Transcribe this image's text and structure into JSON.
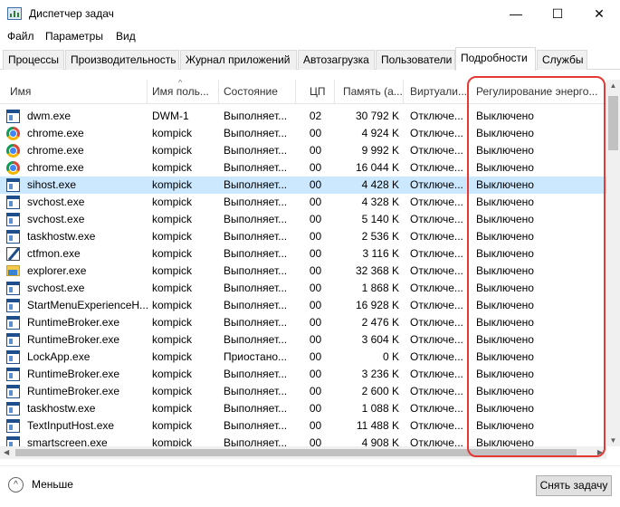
{
  "window": {
    "title": "Диспетчер задач",
    "minimize_glyph": "—",
    "maximize_glyph": "☐",
    "close_glyph": "✕",
    "icon": "task-manager-icon"
  },
  "menu": [
    "Файл",
    "Параметры",
    "Вид"
  ],
  "tabs": [
    {
      "label": "Процессы",
      "active": false
    },
    {
      "label": "Производительность",
      "active": false
    },
    {
      "label": "Журнал приложений",
      "active": false
    },
    {
      "label": "Автозагрузка",
      "active": false
    },
    {
      "label": "Пользователи",
      "active": false
    },
    {
      "label": "Подробности",
      "active": true
    },
    {
      "label": "Службы",
      "active": false
    }
  ],
  "columns": [
    "Имя",
    "Имя поль...",
    "Состояние",
    "ЦП",
    "Память (а...",
    "Виртуали...",
    "Регулирование энерго..."
  ],
  "sort_indicator": "^",
  "rows": [
    {
      "icon": "window-icon",
      "name": "dwm.exe",
      "user": "DWM-1",
      "status": "Выполняет...",
      "cpu": "02",
      "memory": "30 792 K",
      "virt": "Отключе...",
      "power": "Выключено",
      "selected": false
    },
    {
      "icon": "chrome-icon",
      "name": "chrome.exe",
      "user": "kompick",
      "status": "Выполняет...",
      "cpu": "00",
      "memory": "4 924 K",
      "virt": "Отключе...",
      "power": "Выключено",
      "selected": false
    },
    {
      "icon": "chrome-icon",
      "name": "chrome.exe",
      "user": "kompick",
      "status": "Выполняет...",
      "cpu": "00",
      "memory": "9 992 K",
      "virt": "Отключе...",
      "power": "Выключено",
      "selected": false
    },
    {
      "icon": "chrome-icon",
      "name": "chrome.exe",
      "user": "kompick",
      "status": "Выполняет...",
      "cpu": "00",
      "memory": "16 044 K",
      "virt": "Отключе...",
      "power": "Выключено",
      "selected": false
    },
    {
      "icon": "window-icon",
      "name": "sihost.exe",
      "user": "kompick",
      "status": "Выполняет...",
      "cpu": "00",
      "memory": "4 428 K",
      "virt": "Отключе...",
      "power": "Выключено",
      "selected": true
    },
    {
      "icon": "window-icon",
      "name": "svchost.exe",
      "user": "kompick",
      "status": "Выполняет...",
      "cpu": "00",
      "memory": "4 328 K",
      "virt": "Отключе...",
      "power": "Выключено",
      "selected": false
    },
    {
      "icon": "window-icon",
      "name": "svchost.exe",
      "user": "kompick",
      "status": "Выполняет...",
      "cpu": "00",
      "memory": "5 140 K",
      "virt": "Отключе...",
      "power": "Выключено",
      "selected": false
    },
    {
      "icon": "window-icon",
      "name": "taskhostw.exe",
      "user": "kompick",
      "status": "Выполняет...",
      "cpu": "00",
      "memory": "2 536 K",
      "virt": "Отключе...",
      "power": "Выключено",
      "selected": false
    },
    {
      "icon": "pen-icon",
      "name": "ctfmon.exe",
      "user": "kompick",
      "status": "Выполняет...",
      "cpu": "00",
      "memory": "3 116 K",
      "virt": "Отключе...",
      "power": "Выключено",
      "selected": false
    },
    {
      "icon": "folder-icon",
      "name": "explorer.exe",
      "user": "kompick",
      "status": "Выполняет...",
      "cpu": "00",
      "memory": "32 368 K",
      "virt": "Отключе...",
      "power": "Выключено",
      "selected": false
    },
    {
      "icon": "window-icon",
      "name": "svchost.exe",
      "user": "kompick",
      "status": "Выполняет...",
      "cpu": "00",
      "memory": "1 868 K",
      "virt": "Отключе...",
      "power": "Выключено",
      "selected": false
    },
    {
      "icon": "window-icon",
      "name": "StartMenuExperienceH...",
      "user": "kompick",
      "status": "Выполняет...",
      "cpu": "00",
      "memory": "16 928 K",
      "virt": "Отключе...",
      "power": "Выключено",
      "selected": false
    },
    {
      "icon": "window-icon",
      "name": "RuntimeBroker.exe",
      "user": "kompick",
      "status": "Выполняет...",
      "cpu": "00",
      "memory": "2 476 K",
      "virt": "Отключе...",
      "power": "Выключено",
      "selected": false
    },
    {
      "icon": "window-icon",
      "name": "RuntimeBroker.exe",
      "user": "kompick",
      "status": "Выполняет...",
      "cpu": "00",
      "memory": "3 604 K",
      "virt": "Отключе...",
      "power": "Выключено",
      "selected": false
    },
    {
      "icon": "window-icon",
      "name": "LockApp.exe",
      "user": "kompick",
      "status": "Приостано...",
      "cpu": "00",
      "memory": "0 K",
      "virt": "Отключе...",
      "power": "Выключено",
      "selected": false
    },
    {
      "icon": "window-icon",
      "name": "RuntimeBroker.exe",
      "user": "kompick",
      "status": "Выполняет...",
      "cpu": "00",
      "memory": "3 236 K",
      "virt": "Отключе...",
      "power": "Выключено",
      "selected": false
    },
    {
      "icon": "window-icon",
      "name": "RuntimeBroker.exe",
      "user": "kompick",
      "status": "Выполняет...",
      "cpu": "00",
      "memory": "2 600 K",
      "virt": "Отключе...",
      "power": "Выключено",
      "selected": false
    },
    {
      "icon": "window-icon",
      "name": "taskhostw.exe",
      "user": "kompick",
      "status": "Выполняет...",
      "cpu": "00",
      "memory": "1 088 K",
      "virt": "Отключе...",
      "power": "Выключено",
      "selected": false
    },
    {
      "icon": "window-icon",
      "name": "TextInputHost.exe",
      "user": "kompick",
      "status": "Выполняет...",
      "cpu": "00",
      "memory": "11 488 K",
      "virt": "Отключе...",
      "power": "Выключено",
      "selected": false
    },
    {
      "icon": "window-icon",
      "name": "smartscreen.exe",
      "user": "kompick",
      "status": "Выполняет...",
      "cpu": "00",
      "memory": "4 908 K",
      "virt": "Отключе...",
      "power": "Выключено",
      "selected": false
    }
  ],
  "footer": {
    "less_label": "Меньше",
    "less_glyph": "^",
    "end_task_label": "Снять задачу"
  },
  "accent": {
    "highlight_outline": "#e53935",
    "selected_row": "#cce8ff"
  }
}
